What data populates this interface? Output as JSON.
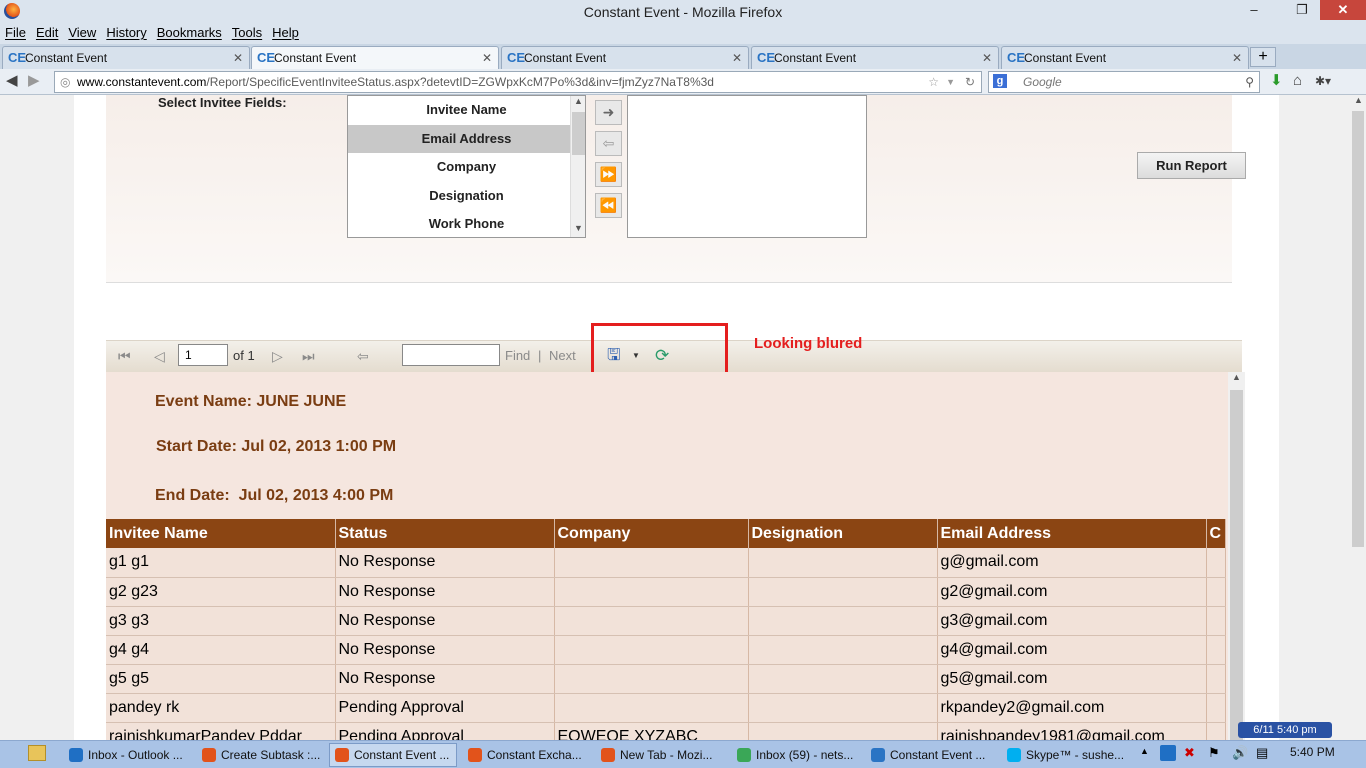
{
  "window": {
    "title": "Constant Event - Mozilla Firefox",
    "minimize": "–",
    "maximize": "❐",
    "close": "✕"
  },
  "menu": [
    "File",
    "Edit",
    "View",
    "History",
    "Bookmarks",
    "Tools",
    "Help"
  ],
  "tabs": [
    {
      "label": "Constant Event",
      "active": false
    },
    {
      "label": "Constant Event",
      "active": true
    },
    {
      "label": "Constant Event",
      "active": false
    },
    {
      "label": "Constant Event",
      "active": false
    },
    {
      "label": "Constant Event",
      "active": false
    }
  ],
  "tab_favicon": "CE",
  "newtab": "+",
  "url": {
    "host": "www.constantevent.com",
    "path": "/Report/SpecificEventInviteeStatus.aspx?detevtID=ZGWpxKcM7Po%3d&inv=fjmZyz7NaT8%3d"
  },
  "search": {
    "placeholder": "Google"
  },
  "fields": {
    "label": "Select Invitee Fields:",
    "items": [
      "Invitee Name",
      "Email Address",
      "Company",
      "Designation",
      "Work Phone"
    ],
    "selected_index": 1
  },
  "run_report": "Run Report",
  "toolbar": {
    "page": "1",
    "of": "of 1",
    "find": "Find",
    "sep": "|",
    "next": "Next"
  },
  "annotation": "Looking blured",
  "report": {
    "event_name": "Event Name: JUNE JUNE",
    "start_date": "Start Date: Jul 02, 2013 1:00 PM",
    "end_date": "End Date:  Jul 02, 2013 4:00 PM",
    "columns": [
      "Invitee Name",
      "Status",
      "Company",
      "Designation",
      "Email Address",
      "C"
    ],
    "rows": [
      [
        "g1 g1",
        "No Response",
        "",
        "",
        "g@gmail.com",
        ""
      ],
      [
        "g2 g23",
        "No Response",
        "",
        "",
        "g2@gmail.com",
        ""
      ],
      [
        "g3 g3",
        "No Response",
        "",
        "",
        "g3@gmail.com",
        ""
      ],
      [
        "g4 g4",
        "No Response",
        "",
        "",
        "g4@gmail.com",
        ""
      ],
      [
        "g5 g5",
        "No Response",
        "",
        "",
        "g5@gmail.com",
        ""
      ],
      [
        "pandey rk",
        "Pending Approval",
        "",
        "",
        "rkpandey2@gmail.com",
        ""
      ],
      [
        "rajnishkumarPandey Pddar",
        "Pending Approval",
        "EQWEQE XYZABC",
        "",
        "rajnishpandey1981@gmail.com",
        ""
      ]
    ]
  },
  "taskbar": {
    "items": [
      {
        "label": "Inbox - Outlook ...",
        "color": "#1f6fc4"
      },
      {
        "label": "Create Subtask :...",
        "color": "#e2531b"
      },
      {
        "label": "Constant Event ...",
        "color": "#e2531b",
        "active": true
      },
      {
        "label": "Constant Excha...",
        "color": "#e2531b"
      },
      {
        "label": "New Tab - Mozi...",
        "color": "#e2531b"
      },
      {
        "label": "Inbox (59) - nets...",
        "color": "#3aa757"
      },
      {
        "label": "Constant Event ...",
        "color": "#2a74c4"
      },
      {
        "label": "Skype™ - sushe...",
        "color": "#00aff0"
      }
    ],
    "clock": "5:40 PM",
    "notification": "6/11  5:40 pm"
  }
}
